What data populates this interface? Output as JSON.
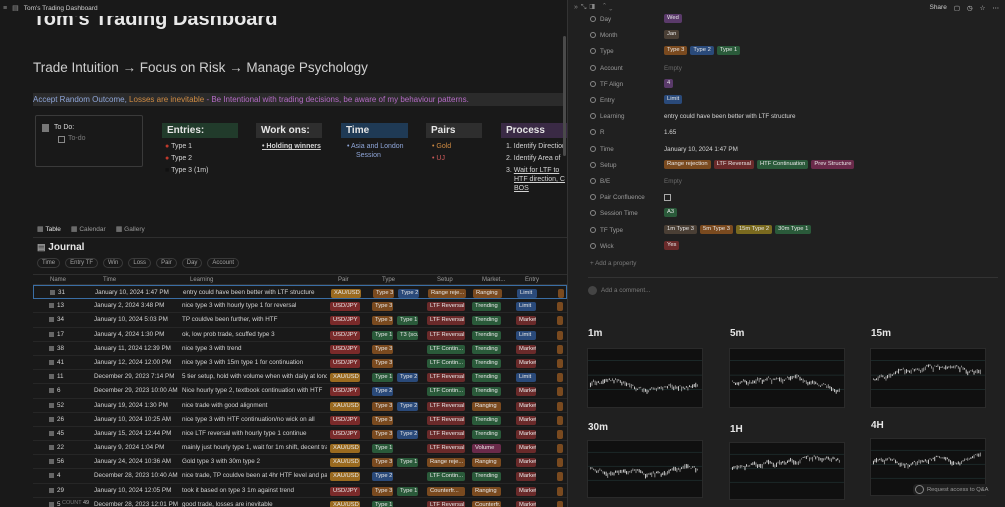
{
  "window": {
    "title": "Tom's Trading Dashboard"
  },
  "page": {
    "title": "Tom's Trading Dashboard",
    "subtitle": "Trade Intuition → Focus on Risk → Manage Psychology",
    "quote_a": "Accept Random Outcome,",
    "quote_b": " Losses are inevitable",
    "quote_c": " - Be Intentional with trading decisions, be aware of my behaviour patterns."
  },
  "todo": {
    "title": "To Do:",
    "placeholder": "To-do"
  },
  "sections": {
    "entries": {
      "title": "Entries:",
      "items": [
        "Type 1",
        "Type 2",
        "Type 3 (1m)"
      ]
    },
    "workons": {
      "title": "Work ons:",
      "items": [
        "Holding winners"
      ]
    },
    "time": {
      "title": "Time",
      "items": [
        "Asia and London",
        "Session"
      ]
    },
    "pairs": {
      "title": "Pairs",
      "items": [
        "Gold",
        "UJ"
      ]
    },
    "process": {
      "title": "Process",
      "items": [
        "Identify Direction",
        "Identify Area of",
        "Wait for LTF to",
        "HTF direction, C",
        "BOS"
      ]
    }
  },
  "tabs": [
    "Table",
    "Calendar",
    "Gallery"
  ],
  "journal": {
    "title": "Journal"
  },
  "filters": [
    "Time",
    "Entry TF",
    "Win",
    "Loss",
    "Pair",
    "Day",
    "Account"
  ],
  "columns": [
    "Name",
    "Time",
    "Learning",
    "Pair",
    "Type",
    "Setup",
    "Market...",
    "Entry"
  ],
  "rows": [
    {
      "n": "31",
      "t": "January 10, 2024 1:47 PM",
      "l": "entry could have been better with LTF structure",
      "p": "XAU/USD",
      "ty": [
        "Type 3",
        "Type 2"
      ],
      "s": "Range reje...",
      "m": "Ranging",
      "e": "Limit"
    },
    {
      "n": "13",
      "t": "January 2, 2024 3:48 PM",
      "l": "nice type 3 with hourly type 1 for reversal",
      "p": "USD/JPY",
      "ty": [
        "Type 3"
      ],
      "s": "LTF Reversal",
      "m": "Trending",
      "e": "Limit"
    },
    {
      "n": "34",
      "t": "January 10, 2024 5:03 PM",
      "l": "TP couldve been further, with HTF",
      "p": "USD/JPY",
      "ty": [
        "Type 3",
        "Type 1"
      ],
      "s": "LTF Reversal",
      "m": "Trending",
      "e": "Market"
    },
    {
      "n": "17",
      "t": "January 4, 2024 1:30 PM",
      "l": "ok, low prob trade, scuffed type 3",
      "p": "USD/JPY",
      "ty": [
        "Type 1",
        "T3 (scuff"
      ],
      "s": "LTF Reversal",
      "m": "Trending",
      "e": "Limit"
    },
    {
      "n": "38",
      "t": "January 11, 2024 12:39 PM",
      "l": "nice type 3 with trend",
      "p": "USD/JPY",
      "ty": [
        "Type 3"
      ],
      "s": "LTF Contin...",
      "m": "Trending",
      "e": "Market"
    },
    {
      "n": "41",
      "t": "January 12, 2024 12:00 PM",
      "l": "nice type 3 with 15m type 1 for continuation",
      "p": "USD/JPY",
      "ty": [
        "Type 3"
      ],
      "s": "LTF Contin...",
      "m": "Trending",
      "e": "Market"
    },
    {
      "n": "11",
      "t": "December 29, 2023 7:14 PM",
      "l": "5 tier setup, hold with volume when with daily at londo",
      "p": "XAU/USD",
      "ty": [
        "Type 1",
        "Type 2"
      ],
      "s": "LTF Reversal",
      "m": "Trending",
      "e": "Limit"
    },
    {
      "n": "6",
      "t": "December 29, 2023 10:00 AM",
      "l": "Nice hourly type 2, textbook continuation with HTF",
      "p": "USD/JPY",
      "ty": [
        "Type 2"
      ],
      "s": "LTF Contin...",
      "m": "Trending",
      "e": "Market"
    },
    {
      "n": "52",
      "t": "January 19, 2024 1:30 PM",
      "l": "nice trade with good alignment",
      "p": "XAU/USD",
      "ty": [
        "Type 3",
        "Type 2"
      ],
      "s": "LTF Reversal",
      "m": "Ranging",
      "e": "Market"
    },
    {
      "n": "26",
      "t": "January 10, 2024 10:25 AM",
      "l": "nice type 3 with HTF continuation/no wick on all",
      "p": "USD/JPY",
      "ty": [
        "Type 3"
      ],
      "s": "LTF Reversal",
      "m": "Trending",
      "e": "Market"
    },
    {
      "n": "45",
      "t": "January 15, 2024 12:44 PM",
      "l": "nice LTF reversal with hourly type 1 continue",
      "p": "USD/JPY",
      "ty": [
        "Type 3",
        "Type 2"
      ],
      "s": "LTF Reversal",
      "m": "Trending",
      "e": "Market"
    },
    {
      "n": "22",
      "t": "January 9, 2024 1:04 PM",
      "l": "mainly just hourly type 1, wait for 1m shift, decent trad",
      "p": "XAU/USD",
      "ty": [
        "Type 1"
      ],
      "s": "LTF Reversal",
      "m": "Volume",
      "e": "Market"
    },
    {
      "n": "56",
      "t": "January 24, 2024 10:36 AM",
      "l": "Gold type 3 with 30m type 2",
      "p": "XAU/USD",
      "ty": [
        "Type 3",
        "Type 1"
      ],
      "s": "Range reje...",
      "m": "Ranging",
      "e": "Market"
    },
    {
      "n": "4",
      "t": "December 28, 2023 10:40 AM",
      "l": "nice trade, TP couldve been at 4hr HTF level and partia",
      "p": "XAU/USD",
      "ty": [
        "Type 2"
      ],
      "s": "LTF Contin...",
      "m": "Trending",
      "e": "Market"
    },
    {
      "n": "29",
      "t": "January 10, 2024 12:05 PM",
      "l": "took it based on type 3 1m against trend",
      "p": "USD/JPY",
      "ty": [
        "Type 3",
        "Type 1"
      ],
      "s": "Counterfr...",
      "m": "Ranging",
      "e": "Market"
    },
    {
      "n": "5",
      "t": "December 28, 2023 12:01 PM",
      "l": "good trade, losses are inevitable",
      "p": "XAU/USD",
      "ty": [
        "Type 1"
      ],
      "s": "LTF Reversal",
      "m": "Counterfr...",
      "e": "Market"
    }
  ],
  "count_label": "COUNT",
  "count_value": "49",
  "topbar_right": {
    "share": "Share"
  },
  "props": [
    {
      "name": "Day",
      "tags": [
        {
          "t": "Wed",
          "c": "#5a3a6a"
        }
      ]
    },
    {
      "name": "Month",
      "tags": [
        {
          "t": "Jan",
          "c": "#4a3f35"
        }
      ]
    },
    {
      "name": "Type",
      "tags": [
        {
          "t": "Type 3",
          "c": "#7a4a1f"
        },
        {
          "t": "Type 2",
          "c": "#2a4a7a"
        },
        {
          "t": "Type 1",
          "c": "#2a5a3a"
        }
      ]
    },
    {
      "name": "Account",
      "empty": "Empty"
    },
    {
      "name": "TF Align",
      "tags": [
        {
          "t": "4",
          "c": "#5a3a6a"
        }
      ]
    },
    {
      "name": "Entry",
      "tags": [
        {
          "t": "Limit",
          "c": "#2a4a7a"
        }
      ]
    },
    {
      "name": "Learning",
      "text": "entry could have been better with LTF structure"
    },
    {
      "name": "R",
      "text": "1.65"
    },
    {
      "name": "Time",
      "text": "January 10, 2024 1:47 PM"
    },
    {
      "name": "Setup",
      "tags": [
        {
          "t": "Range rejection",
          "c": "#7a4a1f"
        },
        {
          "t": "LTF Reversal",
          "c": "#6a2a2a"
        },
        {
          "t": "HTF Continuation",
          "c": "#2a5a3a"
        },
        {
          "t": "Prev Structure",
          "c": "#6a2a4a"
        }
      ]
    },
    {
      "name": "B/E",
      "empty": "Empty"
    },
    {
      "name": "Pair Confluence",
      "checkbox": true
    },
    {
      "name": "Session Time",
      "tags": [
        {
          "t": "A3",
          "c": "#2a5a3a"
        }
      ]
    },
    {
      "name": "TF Type",
      "tags": [
        {
          "t": "1m Type 3",
          "c": "#4a3f35"
        },
        {
          "t": "5m Type 3",
          "c": "#7a4a1f"
        },
        {
          "t": "15m Type 2",
          "c": "#7a6a1f"
        },
        {
          "t": "30m Type 1",
          "c": "#2a5a3a"
        }
      ]
    },
    {
      "name": "Wick",
      "tags": [
        {
          "t": "Yes",
          "c": "#6a2a2a"
        }
      ]
    }
  ],
  "add_property": "Add a property",
  "add_comment": "Add a comment...",
  "charts": [
    "1m",
    "5m",
    "15m",
    "30m",
    "1H",
    "4H"
  ],
  "request_access": "Request access to Q&A",
  "colors": {
    "pair_xau": "#9a6a1f",
    "pair_usd": "#7a2a2a",
    "type3": "#7a4a1f",
    "type2": "#2a4a7a",
    "type1": "#2a5a3a",
    "setup_rev": "#6a2a2a",
    "setup_cont": "#2a5a3a",
    "setup_range": "#7a4a1f",
    "m_trend": "#2a5a3a",
    "m_range": "#7a4a1f",
    "m_vol": "#6a2a4a",
    "e_limit": "#2a4a7a",
    "e_market": "#6a2a2a"
  }
}
